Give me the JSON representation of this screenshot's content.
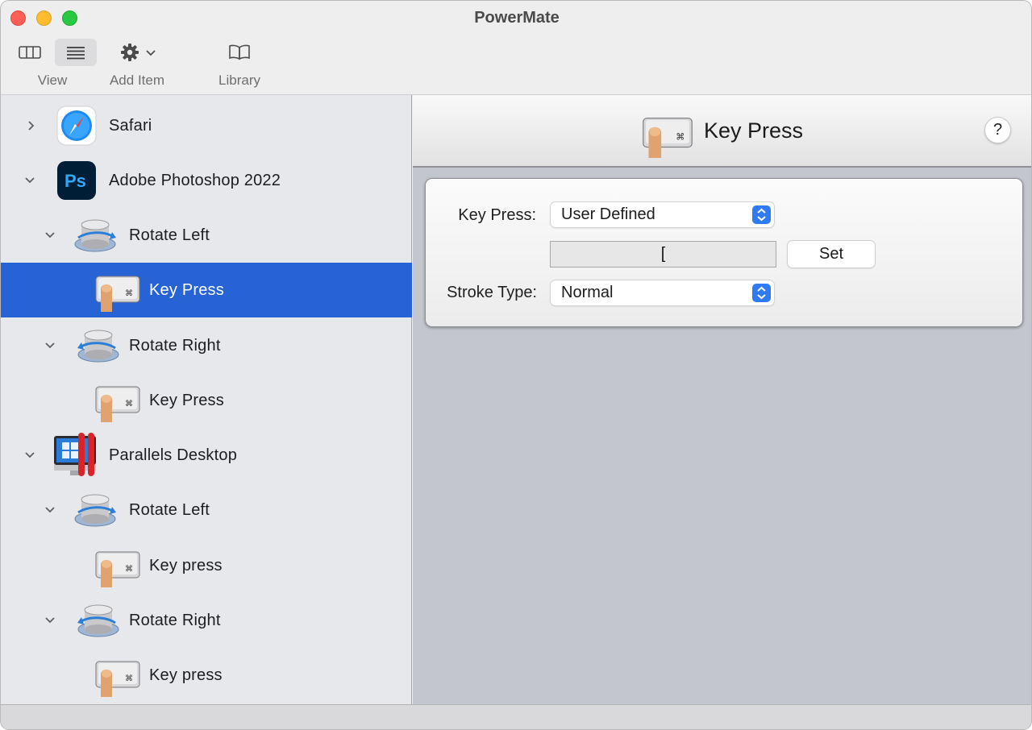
{
  "window": {
    "title": "PowerMate"
  },
  "toolbar": {
    "view_label": "View",
    "add_item_label": "Add Item",
    "library_label": "Library",
    "icons": [
      "columns-view-icon",
      "list-view-icon",
      "gear-icon",
      "chevron-down-icon",
      "book-icon"
    ]
  },
  "sidebar": {
    "items": [
      {
        "label": "Safari",
        "icon": "safari-icon",
        "expanded": false,
        "depth": 0
      },
      {
        "label": "Adobe Photoshop 2022",
        "icon": "photoshop-icon",
        "expanded": true,
        "depth": 0
      },
      {
        "label": "Rotate Left",
        "icon": "rotate-left-icon",
        "expanded": true,
        "depth": 1
      },
      {
        "label": "Key Press",
        "icon": "key-press-icon",
        "depth": 2,
        "selected": true
      },
      {
        "label": "Rotate Right",
        "icon": "rotate-right-icon",
        "expanded": true,
        "depth": 1
      },
      {
        "label": "Key Press",
        "icon": "key-press-icon",
        "depth": 2
      },
      {
        "label": "Parallels Desktop",
        "icon": "parallels-icon",
        "expanded": true,
        "depth": 0
      },
      {
        "label": "Rotate Left",
        "icon": "rotate-left-icon",
        "expanded": true,
        "depth": 1
      },
      {
        "label": "Key press",
        "icon": "key-press-icon",
        "depth": 2
      },
      {
        "label": "Rotate Right",
        "icon": "rotate-right-icon",
        "expanded": true,
        "depth": 1
      },
      {
        "label": "Key press",
        "icon": "key-press-icon",
        "depth": 2
      }
    ]
  },
  "detail": {
    "title": "Key Press",
    "help_label": "?",
    "key_press_label": "Key Press:",
    "key_press_value": "User Defined",
    "key_value": "[",
    "set_label": "Set",
    "stroke_type_label": "Stroke Type:",
    "stroke_type_value": "Normal"
  },
  "colors": {
    "selection": "#2863d6",
    "accent": "#2f7bf5",
    "sidebar_bg": "#e7e8ec",
    "detail_bg": "#c3c6cd"
  }
}
